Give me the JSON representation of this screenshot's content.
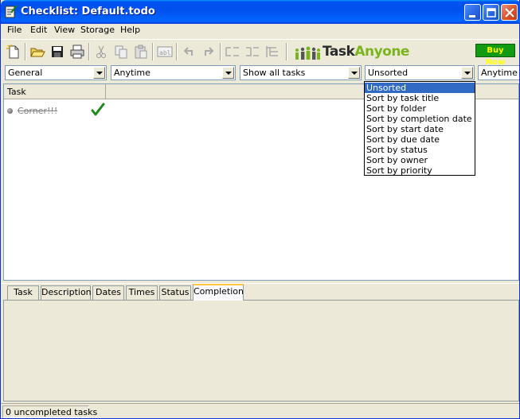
{
  "window": {
    "title": "Checklist: Default.todo"
  },
  "menu": [
    "File",
    "Edit",
    "View",
    "Storage",
    "Help"
  ],
  "toolbar": {
    "logo_task": "Task",
    "logo_anyone": "Anyone",
    "buy_now": "Buy Now"
  },
  "filters": {
    "folder": "General",
    "date_range": "Anytime",
    "show": "Show all tasks",
    "sort": "Unsorted",
    "due": "Anytime"
  },
  "list": {
    "column_task": "Task",
    "tasks": [
      {
        "title": "Corner!!!",
        "completed": true
      }
    ]
  },
  "sort_options": [
    "Unsorted",
    "Sort by task title",
    "Sort by folder",
    "Sort by completion date",
    "Sort by start date",
    "Sort by due date",
    "Sort by status",
    "Sort by owner",
    "Sort by priority"
  ],
  "selected_sort_index": 0,
  "tabs": [
    "Task",
    "Description",
    "Dates",
    "Times",
    "Status",
    "Completion"
  ],
  "active_tab_index": 5,
  "status": {
    "text": "0 uncompleted tasks"
  },
  "colors": {
    "titlebar": "#0054e3",
    "selection": "#316ac5",
    "check": "#1f8a1f",
    "buy_now_bg": "#139a13",
    "buy_now_fg": "#ffff00",
    "logo_task": "#2a2a2a",
    "logo_anyone": "#7ab51d"
  }
}
